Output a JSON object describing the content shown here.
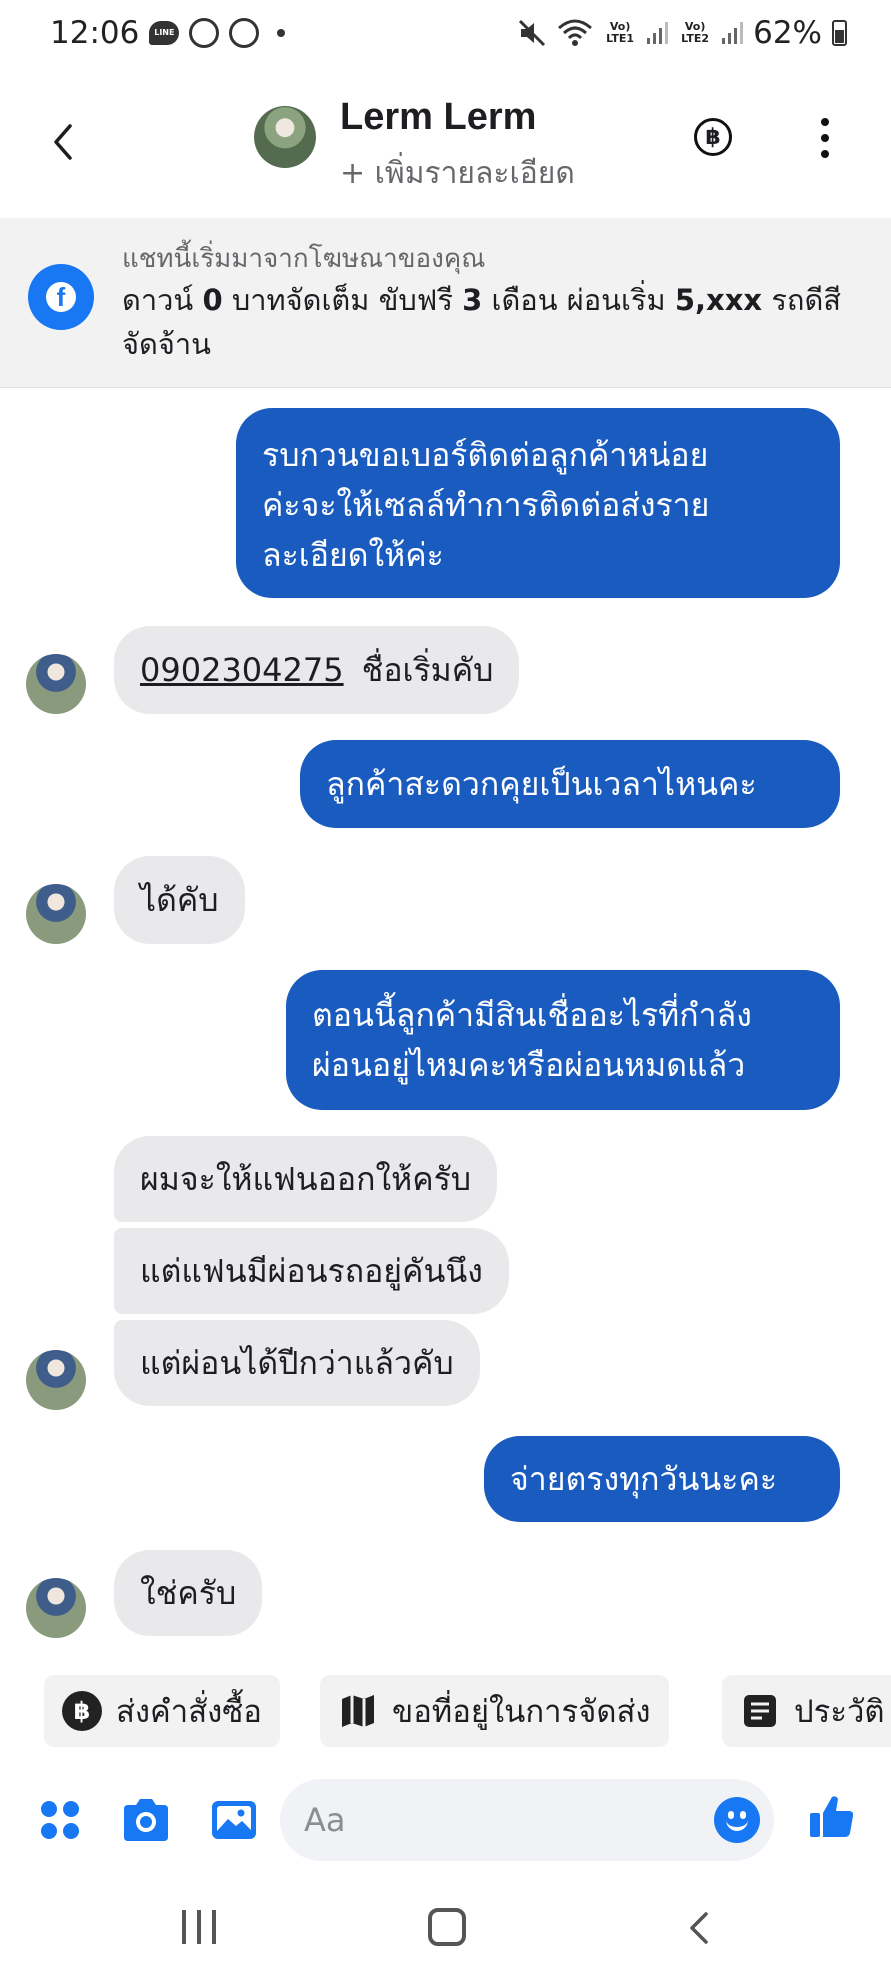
{
  "status_bar": {
    "time": "12:06",
    "line_label": "LINE",
    "sim1": "Vo) LTE1",
    "sim2": "Vo) LTE2",
    "battery": "62%"
  },
  "header": {
    "contact_name": "Lerm Lerm",
    "subtitle": "+ เพิ่มรายละเอียด",
    "baht_symbol": "฿"
  },
  "ad_banner": {
    "caption": "แชทนี้เริ่มมาจากโฆษณาของคุณ",
    "text_part1": "ดาวน์ ",
    "text_bold1": "0",
    "text_part2": " บาทจัดเต็ม ขับฟรี ",
    "text_bold2": "3",
    "text_part3": " เดือน ผ่อนเริ่ม ",
    "text_bold3": "5,xxx",
    "text_part4": " รถดีสีจัดจ้าน"
  },
  "messages": {
    "m1": {
      "line1": "รบกวนขอเบอร์ติดต่อลูกค้าหน่อย",
      "line2": "ค่ะจะให้เซลล์ทำการติดต่อส่งราย",
      "line3": "ละเอียดให้ค่ะ"
    },
    "m2": {
      "phone": "0902304275",
      "text": "ชื่อเริ่มคับ"
    },
    "m3": "ลูกค้าสะดวกคุยเป็นเวลาไหนคะ",
    "m4": "ได้คับ",
    "m5": {
      "line1": "ตอนนี้ลูกค้ามีสินเชื่ออะไรที่กำลัง",
      "line2": "ผ่อนอยู่ไหมคะหรือผ่อนหมดแล้ว"
    },
    "m6": "ผมจะให้แฟนออกให้ครับ",
    "m7": "แต่แฟนมีผ่อนรถอยู่คันนึง",
    "m8": "แต่ผ่อนได้ปีกว่าแล้วคับ",
    "m9": "จ่ายตรงทุกวันนะคะ",
    "m10": "ใช่ครับ"
  },
  "quick_replies": {
    "order": "ส่งคำสั่งซื้อ",
    "address": "ขอที่อยู่ในการจัดส่ง",
    "history": "ประวัติ"
  },
  "composer": {
    "placeholder": "Aa"
  },
  "colors": {
    "outgoing_bubble": "#1a5bbf",
    "incoming_bubble": "#e9e9eb",
    "facebook_blue": "#1877f2"
  }
}
